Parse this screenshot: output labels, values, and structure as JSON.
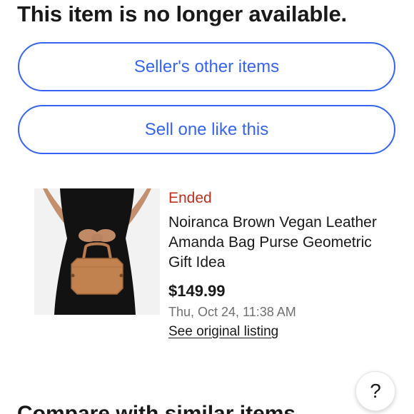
{
  "header": {
    "title": "This item is no longer available."
  },
  "actions": {
    "seller_other_items": "Seller's other items",
    "sell_one_like_this": "Sell one like this"
  },
  "item": {
    "status": "Ended",
    "title": "Noiranca Brown Vegan Leather Amanda Bag Purse Geometric Gift Idea",
    "price": "$149.99",
    "ended_at": "Thu, Oct 24, 11:38 AM",
    "link_label": "See original listing",
    "image_icon": "product-photo"
  },
  "help": {
    "label": "?",
    "icon": "help-icon"
  },
  "compare": {
    "title": "Compare with similar items"
  },
  "colors": {
    "accent": "#3665f3",
    "status_ended": "#c1301f",
    "text": "#191919",
    "muted": "#707070"
  }
}
